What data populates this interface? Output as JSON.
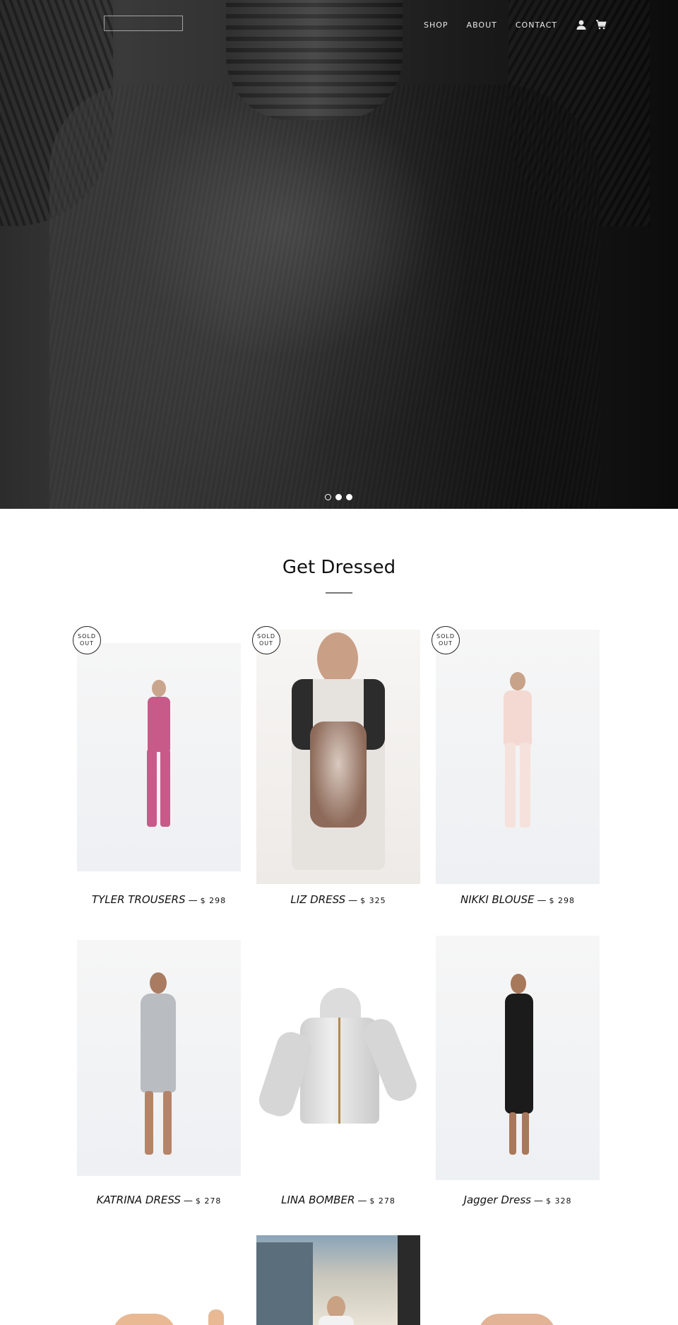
{
  "header": {
    "nav": [
      "SHOP",
      "ABOUT",
      "CONTACT"
    ],
    "icons": [
      "account-icon",
      "cart-icon"
    ]
  },
  "hero": {
    "slides": 3,
    "active_slide": 1
  },
  "section": {
    "title": "Get Dressed"
  },
  "products": [
    {
      "name": "TYLER TROUSERS",
      "sep": "—",
      "price": "$ 298",
      "sold_out": "SOLD OUT",
      "color": "#c85a8a"
    },
    {
      "name": "LIZ DRESS",
      "sep": "—",
      "price": "$ 325",
      "sold_out": "SOLD OUT",
      "color": "#2c2c2c"
    },
    {
      "name": "NIKKI BLOUSE",
      "sep": "—",
      "price": "$ 298",
      "sold_out": "SOLD OUT",
      "color": "#f4d9d2"
    },
    {
      "name": "KATRINA DRESS",
      "sep": "—",
      "price": "$ 278",
      "color": "#b9bcc1"
    },
    {
      "name": "LINA BOMBER",
      "sep": "—",
      "price": "$ 278",
      "color": "#d8d8d8"
    },
    {
      "name": "Jagger Dress",
      "sep": "—",
      "price": "$ 328",
      "color": "#1b1b1b"
    }
  ]
}
